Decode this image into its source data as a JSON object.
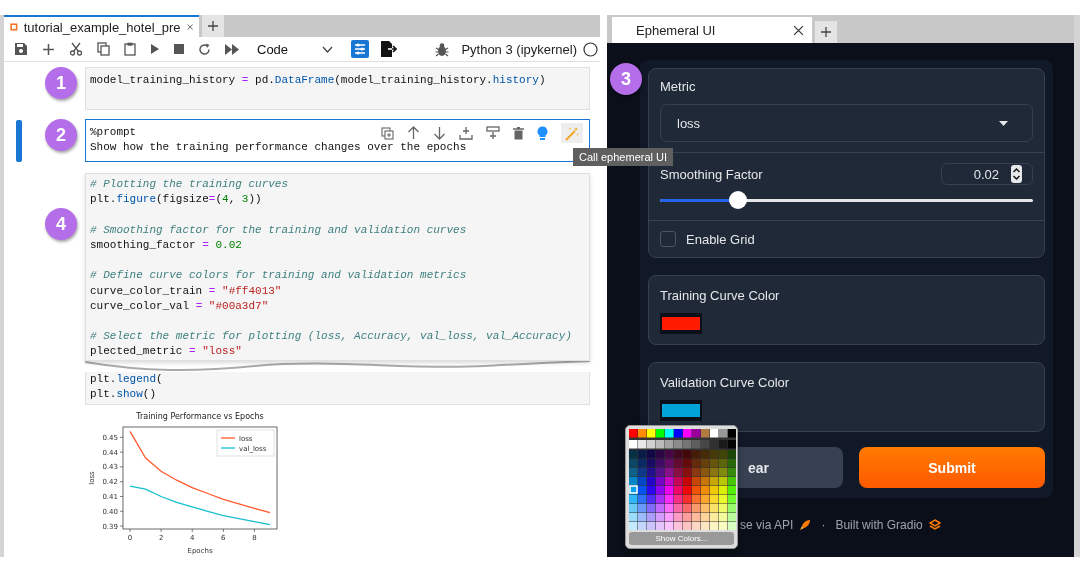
{
  "notebook": {
    "tab": {
      "title": "tutorial_example_hotel_pre",
      "selected": true
    },
    "toolbar": {
      "cell_type": "Code",
      "kernel": "Python 3 (ipykernel)"
    },
    "cells": [
      {
        "badge": "1",
        "selected": false,
        "blocks": [
          [
            [
              {
                "t": "model_training_history "
              },
              {
                "t": "=",
                "kind": "op"
              },
              {
                "t": " pd."
              },
              {
                "t": "DataFrame",
                "kind": "fn"
              },
              {
                "t": "(model_training_history."
              },
              {
                "t": "history",
                "kind": "fn"
              },
              {
                "t": ")"
              }
            ]
          ]
        ]
      },
      {
        "badge": "2",
        "selected": true,
        "blocks": [
          [
            [
              {
                "t": "%prompt"
              }
            ],
            [
              {
                "t": "Show how the training performance changes over the epochs"
              }
            ]
          ]
        ]
      },
      {
        "badge": "4",
        "selected": false,
        "blocks": [
          [
            [
              {
                "t": "# Plotting the training curves",
                "kind": "comment"
              }
            ],
            [
              {
                "t": "plt."
              },
              {
                "t": "figure",
                "kind": "fn"
              },
              {
                "t": "(figsize"
              },
              {
                "t": "=",
                "kind": "op"
              },
              {
                "t": "("
              },
              {
                "t": "4",
                "kind": "num"
              },
              {
                "t": ", "
              },
              {
                "t": "3",
                "kind": "num"
              },
              {
                "t": "))"
              }
            ]
          ],
          [
            [
              {
                "t": "# Smoothing factor for the training and validation curves",
                "kind": "comment"
              }
            ],
            [
              {
                "t": "smoothing_factor "
              },
              {
                "t": "=",
                "kind": "op"
              },
              {
                "t": " 0.02",
                "kind": "num"
              }
            ]
          ],
          [
            [
              {
                "t": "# Define curve colors for training and validation metrics",
                "kind": "comment"
              }
            ],
            [
              {
                "t": "curve_color_train "
              },
              {
                "t": "=",
                "kind": "op"
              },
              {
                "t": " \"#ff4013\"",
                "kind": "str"
              }
            ],
            [
              {
                "t": "curve_color_val "
              },
              {
                "t": "=",
                "kind": "op"
              },
              {
                "t": " \"#00a3d7\"",
                "kind": "str"
              }
            ]
          ],
          [
            [
              {
                "t": "# Select the metric for plotting (loss, Accuracy, val_loss, val_Accuracy)",
                "kind": "comment"
              }
            ],
            [
              {
                "t": "plected_metric "
              },
              {
                "t": "=",
                "kind": "op"
              },
              {
                "t": " \"loss\"",
                "kind": "str"
              }
            ]
          ]
        ],
        "tail_lines": [
          [
            {
              "t": "plt."
            },
            {
              "t": "legend",
              "kind": "fn"
            },
            {
              "t": "("
            }
          ],
          [
            {
              "t": "plt."
            },
            {
              "t": "show",
              "kind": "fn"
            },
            {
              "t": "()"
            }
          ]
        ]
      }
    ],
    "tooltip": "Call ephemeral UI",
    "chart_data": {
      "type": "line",
      "title": "Training Performance vs Epochs",
      "xlabel": "Epochs",
      "ylabel": "loss",
      "x": [
        0,
        1,
        2,
        3,
        4,
        5,
        6,
        7,
        8,
        9
      ],
      "series": [
        {
          "name": "loss",
          "color": "#ff5a30",
          "values": [
            0.454,
            0.436,
            0.427,
            0.421,
            0.416,
            0.412,
            0.408,
            0.405,
            0.402,
            0.399
          ]
        },
        {
          "name": "val_loss",
          "color": "#17becf",
          "values": [
            0.417,
            0.415,
            0.41,
            0.406,
            0.403,
            0.4,
            0.397,
            0.395,
            0.393,
            0.391
          ]
        }
      ],
      "xticks": [
        0,
        2,
        4,
        6,
        8
      ],
      "yticks": [
        {
          "value": 0.39,
          "label": "0.39"
        },
        {
          "value": 0.4,
          "label": "0.40"
        },
        {
          "value": 0.41,
          "label": "0.41"
        },
        {
          "value": 0.42,
          "label": "0.42"
        },
        {
          "value": 0.43,
          "label": "0.43"
        },
        {
          "value": 0.44,
          "label": "0.44"
        },
        {
          "value": 0.45,
          "label": "0.45"
        }
      ],
      "xlim": [
        -0.45,
        9.45
      ],
      "ylim": [
        0.388,
        0.457
      ],
      "legend": true
    }
  },
  "app": {
    "tab": {
      "title": "Ephemeral UI",
      "selected": true
    },
    "badge": "3",
    "metric": {
      "label": "Metric",
      "value": "loss"
    },
    "smoothing": {
      "label": "Smoothing Factor",
      "value": "0.02",
      "level": 0.21
    },
    "grid": {
      "label": "Enable Grid",
      "checked": false
    },
    "colors": [
      {
        "label": "Training Curve Color",
        "color": "#ff1a00"
      },
      {
        "label": "Validation Curve Color",
        "color": "#00a3d7"
      }
    ],
    "buttons": [
      {
        "label": "ear",
        "kind": "secondary"
      },
      {
        "label": "Submit",
        "kind": "primary"
      }
    ],
    "footer": {
      "api": "se via API",
      "separator": "·",
      "built": "Built with Gradio"
    },
    "picker": {
      "button": "Show Colors..."
    }
  }
}
